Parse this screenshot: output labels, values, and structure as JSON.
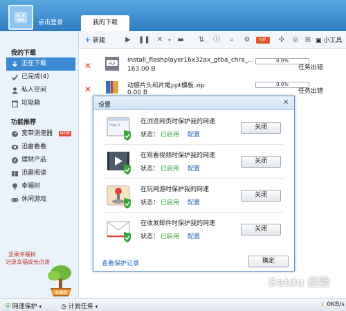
{
  "header": {
    "login_text": "点击登录",
    "active_tab": "我的下载"
  },
  "sidebar": {
    "section1": "我的下载",
    "downloading": "正在下载",
    "completed": "已完成(4)",
    "private": "私人空间",
    "trash": "垃圾箱",
    "section2": "功能推荐",
    "features": [
      {
        "label": "宽带测速器",
        "badge": "NEW"
      },
      {
        "label": "迅雷看看"
      },
      {
        "label": "理财产品"
      },
      {
        "label": "迅雷阅读"
      },
      {
        "label": "幸福树"
      },
      {
        "label": "休闲游戏"
      }
    ],
    "promo_line1": "坚果幸福树",
    "promo_line2": "记录幸福成长点滴",
    "promo_label": "幸福树"
  },
  "toolbar": {
    "new_label": "新建",
    "tools_label": "小工具",
    "vip_label": "VIP"
  },
  "tasks": [
    {
      "name": "install_flashplayer16x32ax_gtba_chra_...",
      "size": "163.00 B",
      "progress": "0.0%",
      "status": "任务出错"
    },
    {
      "name": "动感片头和片尾ppt模板.zip",
      "size": "0.00 B",
      "progress": "0.0%",
      "status": "任务出错"
    }
  ],
  "dialog": {
    "title": "设置",
    "close_icon": "×",
    "rows": [
      {
        "text": "在浏览网页时保护我的网速",
        "status_label": "状态：",
        "status_value": "已启用",
        "config": "配置",
        "button": "关闭",
        "icon": "browser-shield-icon",
        "url_hint": "http://"
      },
      {
        "text": "在观看视频时保护我的网速",
        "status_label": "状态：",
        "status_value": "已启用",
        "config": "配置",
        "button": "关闭",
        "icon": "video-shield-icon"
      },
      {
        "text": "在玩网游时保护我的网速",
        "status_label": "状态：",
        "status_value": "已启用",
        "config": "配置",
        "button": "关闭",
        "icon": "game-shield-icon"
      },
      {
        "text": "在收发邮件时保护我的网速",
        "status_label": "状态：",
        "status_value": "已启用",
        "config": "配置",
        "button": "关闭",
        "icon": "mail-shield-icon"
      }
    ],
    "history_link": "查看保护记录",
    "ok_label": "确定"
  },
  "statusbar": {
    "protect": "网速保护",
    "plan": "计划任务",
    "speed": "0KB/s"
  },
  "watermark": "Baidu 经验",
  "colors": {
    "accent": "#3d8ad4",
    "error": "#d83a2a",
    "enabled": "#2e9b2e",
    "link": "#1e66b8"
  }
}
